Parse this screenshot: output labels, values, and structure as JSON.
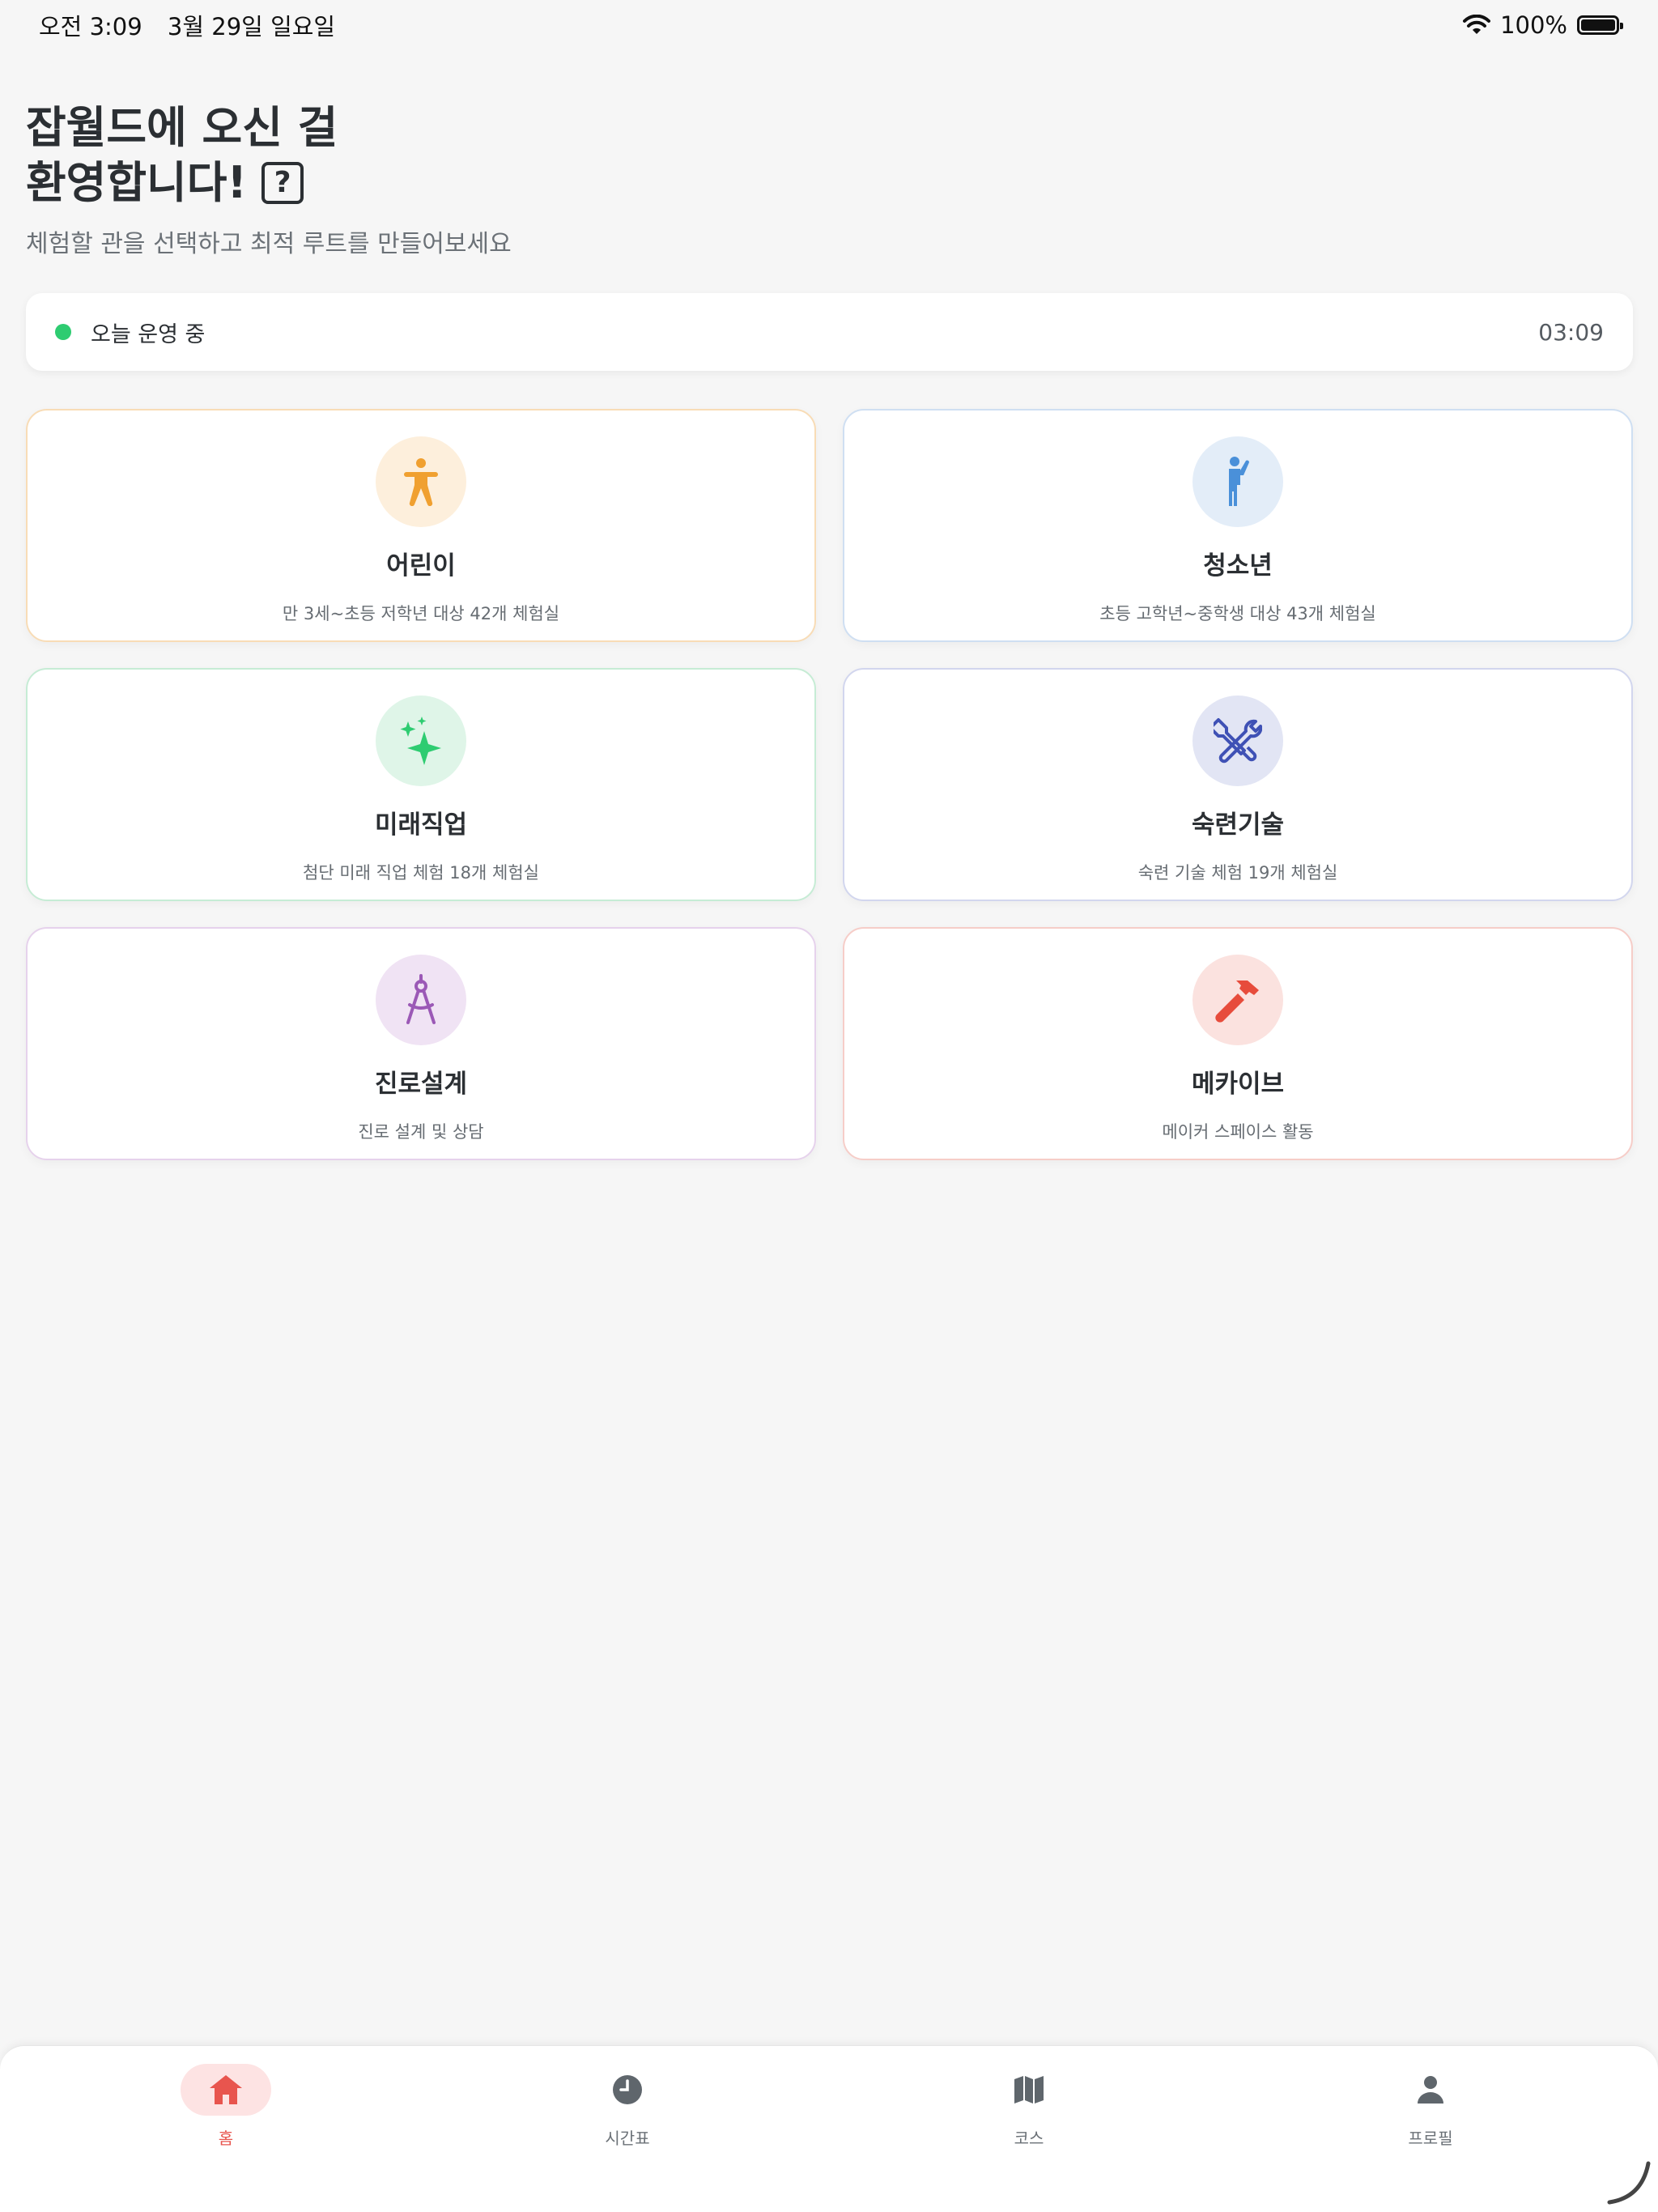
{
  "status_bar": {
    "time": "오전 3:09",
    "date": "3월 29일 일요일",
    "battery": "100%"
  },
  "header": {
    "title_line1": "잡월드에 오신 걸",
    "title_line2": "환영합니다!",
    "help_symbol": "?",
    "subtitle": "체험할 관을 선택하고 최적 루트를 만들어보세요"
  },
  "operation": {
    "status": "오늘 운영 중",
    "time": "03:09",
    "status_color": "#2ecc71"
  },
  "halls": [
    {
      "name": "어린이",
      "desc": "만 3세~초등 저학년 대상 42개 체험실",
      "icon": "child-icon",
      "color": "#f0a030",
      "bg": "#fdefdc",
      "border": "#f8dcb6"
    },
    {
      "name": "청소년",
      "desc": "초등 고학년~중학생 대상 43개 체험실",
      "icon": "teen-icon",
      "color": "#4a90d9",
      "bg": "#e3edf8",
      "border": "#cfdff2"
    },
    {
      "name": "미래직업",
      "desc": "첨단 미래 직업 체험 18개 체험실",
      "icon": "sparkle-icon",
      "color": "#2ecc71",
      "bg": "#dff5e8",
      "border": "#c6ecd5"
    },
    {
      "name": "숙련기술",
      "desc": "숙련 기술 체험 19개 체험실",
      "icon": "tools-icon",
      "color": "#3f51b5",
      "bg": "#e2e5f4",
      "border": "#d2d6ee"
    },
    {
      "name": "진로설계",
      "desc": "진로 설계 및 상담",
      "icon": "compass-icon",
      "color": "#9b59b6",
      "bg": "#f0e3f4",
      "border": "#e6d2ec"
    },
    {
      "name": "메카이브",
      "desc": "메이커 스페이스 활동",
      "icon": "hammer-icon",
      "color": "#e74c3c",
      "bg": "#fbe2df",
      "border": "#f6cdc8"
    }
  ],
  "tabs": [
    {
      "label": "홈",
      "icon": "home-icon",
      "active": true
    },
    {
      "label": "시간표",
      "icon": "clock-icon",
      "active": false
    },
    {
      "label": "코스",
      "icon": "map-icon",
      "active": false
    },
    {
      "label": "프로필",
      "icon": "person-icon",
      "active": false
    }
  ],
  "colors": {
    "accent": "#e8554e",
    "background": "#f6f6f6",
    "inactive_icon": "#5f666c"
  }
}
